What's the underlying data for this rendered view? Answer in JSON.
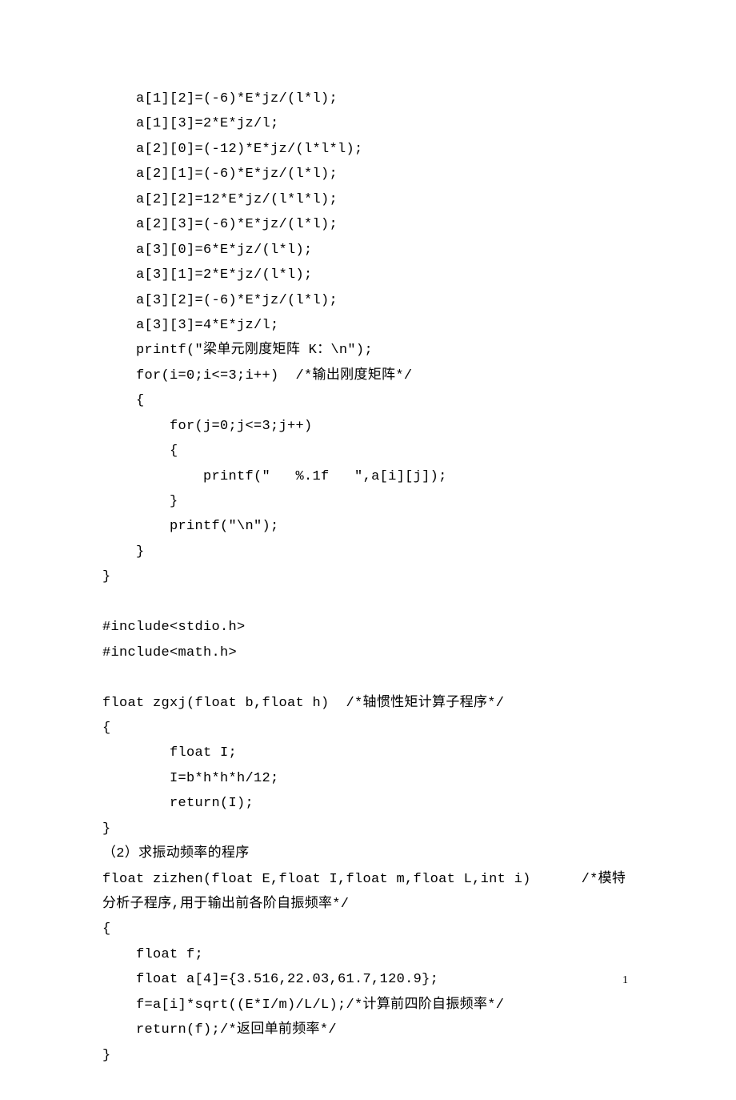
{
  "lines": [
    "    a[1][2]=(-6)*E*jz/(l*l);",
    "    a[1][3]=2*E*jz/l;",
    "    a[2][0]=(-12)*E*jz/(l*l*l);",
    "    a[2][1]=(-6)*E*jz/(l*l);",
    "    a[2][2]=12*E*jz/(l*l*l);",
    "    a[2][3]=(-6)*E*jz/(l*l);",
    "    a[3][0]=6*E*jz/(l*l);",
    "    a[3][1]=2*E*jz/(l*l);",
    "    a[3][2]=(-6)*E*jz/(l*l);",
    "    a[3][3]=4*E*jz/l;",
    "    printf(\"梁单元刚度矩阵 K：\\n\");",
    "    for(i=0;i<=3;i++)  /*输出刚度矩阵*/",
    "    {",
    "        for(j=0;j<=3;j++)",
    "        {",
    "            printf(\"   %.1f   \",a[i][j]);",
    "        }",
    "        printf(\"\\n\");",
    "    }",
    "}",
    "",
    "#include<stdio.h>",
    "#include<math.h>",
    "",
    "float zgxj(float b,float h)  /*轴惯性矩计算子程序*/",
    "{",
    "        float I;",
    "        I=b*h*h*h/12;",
    "        return(I);",
    "}",
    "（2）求振动频率的程序",
    "float zizhen(float E,float I,float m,float L,int i)      /*模特分析子程序,用于输出前各阶自振频率*/",
    "{",
    "    float f;",
    "    float a[4]={3.516,22.03,61.7,120.9};",
    "    f=a[i]*sqrt((E*I/m)/L/L);/*计算前四阶自振频率*/",
    "    return(f);/*返回单前频率*/",
    "}"
  ],
  "page_number": "1"
}
